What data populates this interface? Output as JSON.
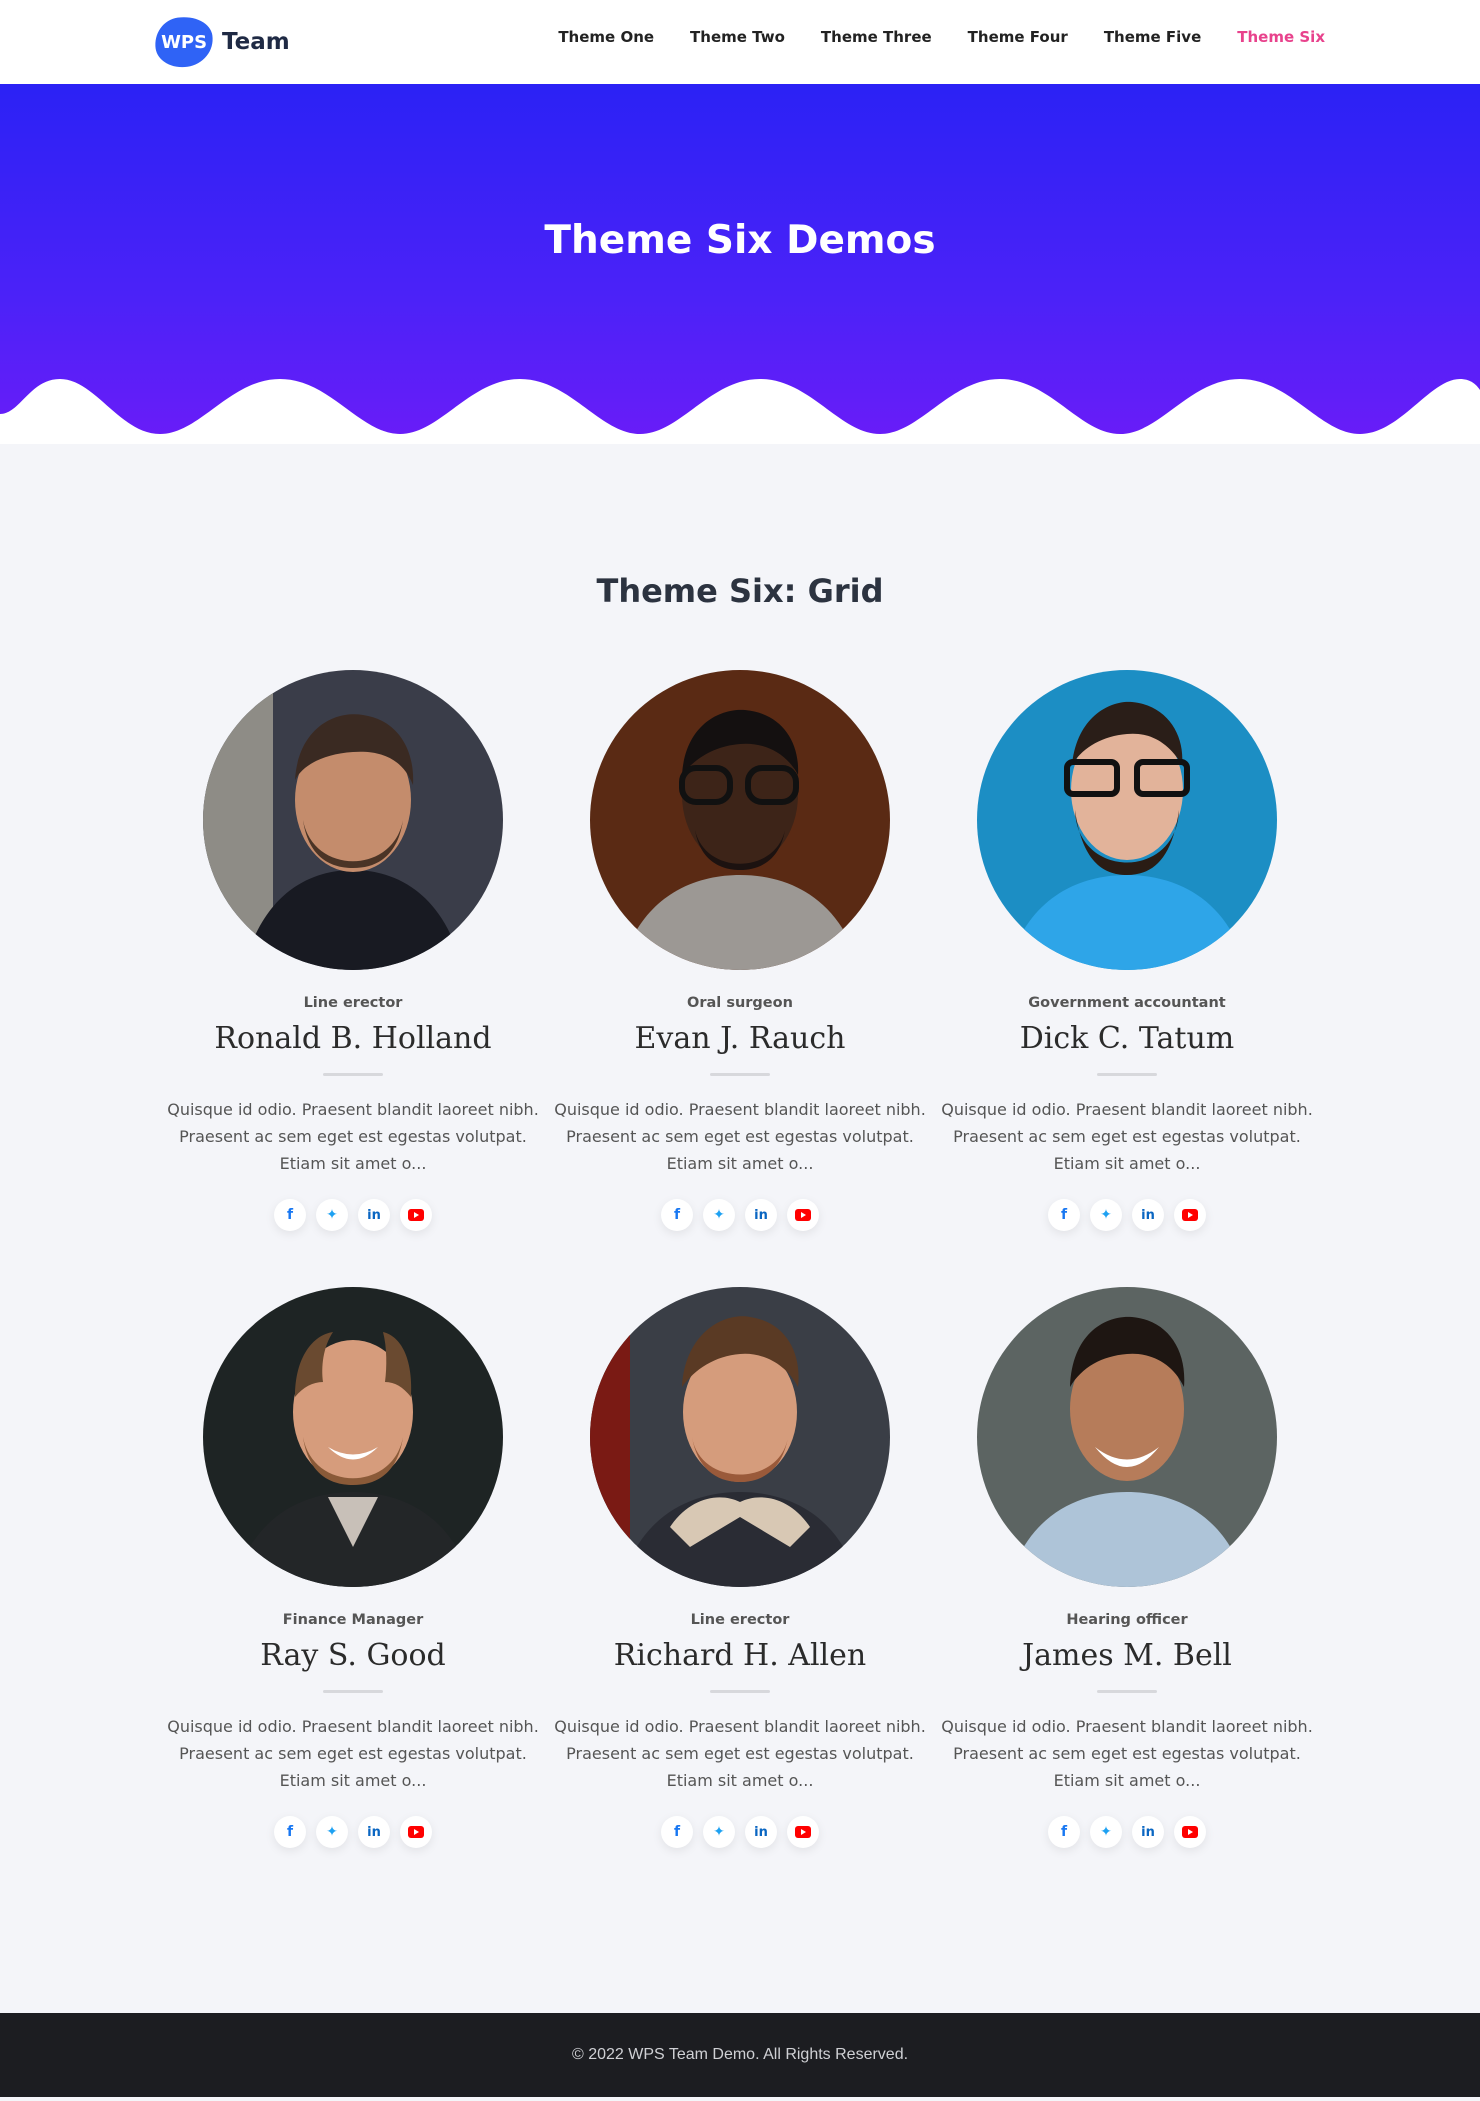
{
  "header": {
    "logo_badge": "WPS",
    "logo_text": "Team",
    "nav": [
      {
        "label": "Theme One",
        "active": false
      },
      {
        "label": "Theme Two",
        "active": false
      },
      {
        "label": "Theme Three",
        "active": false
      },
      {
        "label": "Theme Four",
        "active": false
      },
      {
        "label": "Theme Five",
        "active": false
      },
      {
        "label": "Theme Six",
        "active": true
      }
    ]
  },
  "hero": {
    "title": "Theme Six Demos"
  },
  "main": {
    "section_title": "Theme Six: Grid",
    "members": [
      {
        "role": "Line erector",
        "name": "Ronald B. Holland",
        "bio": "Quisque id odio. Praesent blandit laoreet nibh. Praesent ac sem eget est egestas volutpat. Etiam sit amet o..."
      },
      {
        "role": "Oral surgeon",
        "name": "Evan J. Rauch",
        "bio": "Quisque id odio. Praesent blandit laoreet nibh. Praesent ac sem eget est egestas volutpat. Etiam sit amet o..."
      },
      {
        "role": "Government accountant",
        "name": "Dick C. Tatum",
        "bio": "Quisque id odio. Praesent blandit laoreet nibh. Praesent ac sem eget est egestas volutpat. Etiam sit amet o..."
      },
      {
        "role": "Finance Manager",
        "name": "Ray S. Good",
        "bio": "Quisque id odio. Praesent blandit laoreet nibh. Praesent ac sem eget est egestas volutpat. Etiam sit amet o..."
      },
      {
        "role": "Line erector",
        "name": "Richard H. Allen",
        "bio": "Quisque id odio. Praesent blandit laoreet nibh. Praesent ac sem eget est egestas volutpat. Etiam sit amet o..."
      },
      {
        "role": "Hearing officer",
        "name": "James M. Bell",
        "bio": "Quisque id odio. Praesent blandit laoreet nibh. Praesent ac sem eget est egestas volutpat. Etiam sit amet o..."
      }
    ],
    "social_icons": [
      "facebook-icon",
      "twitter-icon",
      "linkedin-icon",
      "youtube-icon"
    ]
  },
  "footer": {
    "copyright": "© 2022 WPS Team Demo. All Rights Reserved."
  },
  "colors": {
    "hero_top": "#2b22f5",
    "hero_bottom": "#6a1cf8",
    "nav_active": "#e8428c",
    "footer_bg": "#1c1d21"
  }
}
